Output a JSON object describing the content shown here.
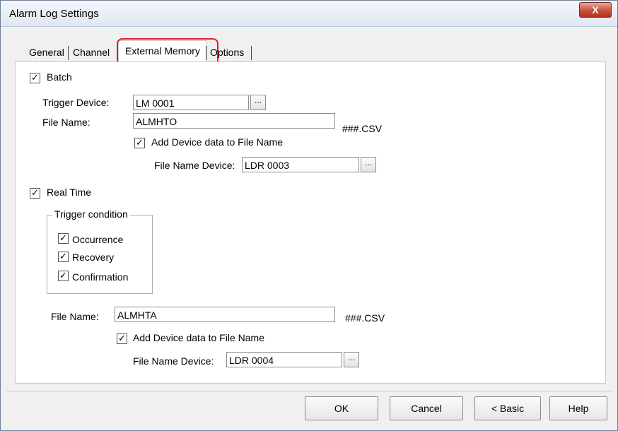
{
  "window": {
    "title": "Alarm Log Settings",
    "close_glyph": "X",
    "close_icon": "close-icon"
  },
  "tabs": [
    {
      "label": "General"
    },
    {
      "label": "Channel"
    },
    {
      "label": "External Memory"
    },
    {
      "label": "Options"
    }
  ],
  "active_tab": "External Memory",
  "batch": {
    "checkbox_label": "Batch",
    "checked": true,
    "trigger_device_label": "Trigger Device:",
    "trigger_device_value": "LM 0001",
    "file_name_label": "File Name:",
    "file_name_value": "ALMHTO",
    "suffix": "###.CSV",
    "add_device_label": "Add Device data to File Name",
    "add_device_checked": true,
    "file_name_device_label": "File Name Device:",
    "file_name_device_value": "LDR 0003"
  },
  "realtime": {
    "checkbox_label": "Real Time",
    "checked": true,
    "trigger_group_title": "Trigger condition",
    "occurrence_label": "Occurrence",
    "recovery_label": "Recovery",
    "confirmation_label": "Confirmation",
    "file_name_label": "File Name:",
    "file_name_value": "ALMHTA",
    "suffix": "###.CSV",
    "add_device_label": "Add Device data to File Name",
    "add_device_checked": true,
    "file_name_device_label": "File Name Device:",
    "file_name_device_value": "LDR 0004"
  },
  "browse_glyph": "...",
  "check_glyph": "✓",
  "buttons": {
    "ok": "OK",
    "cancel": "Cancel",
    "basic": "< Basic",
    "help": "Help"
  },
  "colors": {
    "highlight": "#e0202a",
    "close_button": "#c7503b"
  }
}
